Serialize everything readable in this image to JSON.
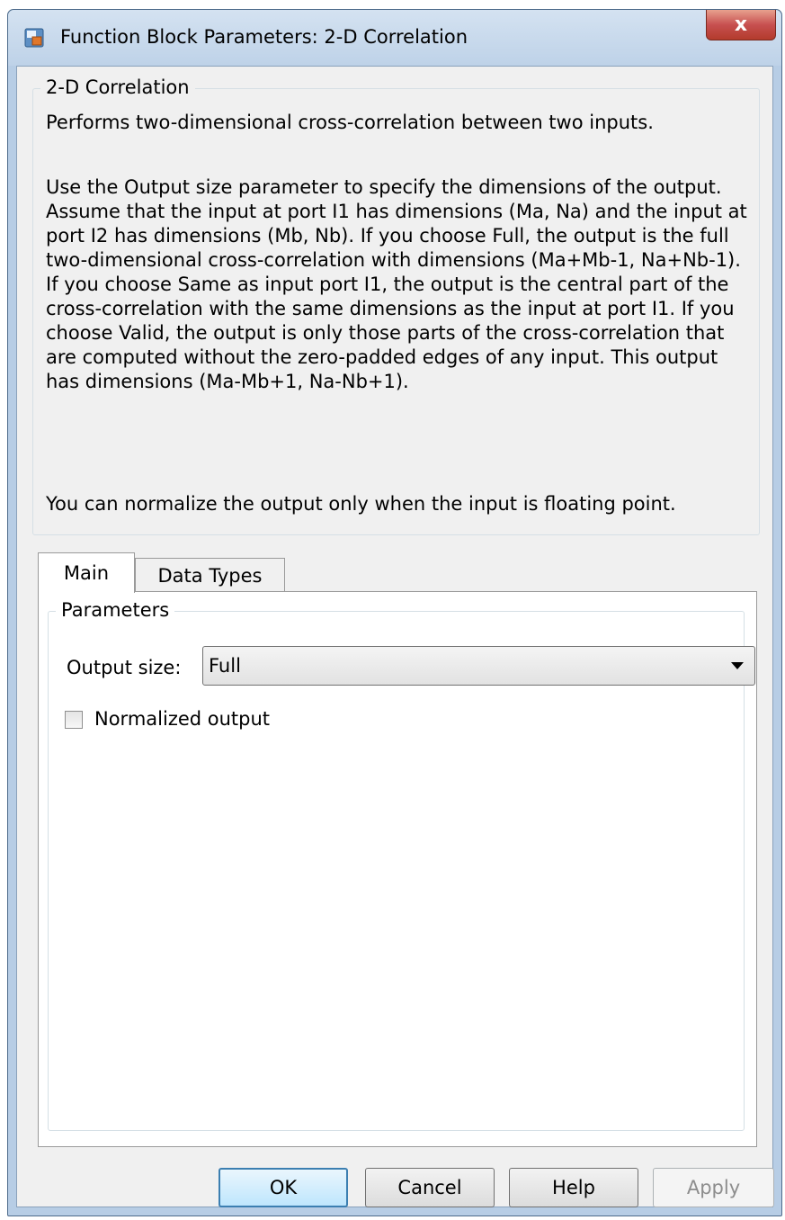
{
  "window": {
    "title": "Function Block Parameters: 2-D Correlation",
    "close_label": "x"
  },
  "description": {
    "group_title": "2-D Correlation",
    "paragraphs": [
      "Performs two-dimensional cross-correlation between two inputs.",
      "Use the Output size parameter to specify the dimensions of the output. Assume that the input at port I1 has dimensions (Ma, Na) and the input at port I2 has dimensions (Mb, Nb). If you choose Full, the output is the full two-dimensional cross-correlation with dimensions (Ma+Mb-1, Na+Nb-1). If you choose Same as input port I1, the output is the central part of the cross-correlation with the same dimensions as the input at port I1. If you choose Valid, the output is only those parts of the cross-correlation that are computed without the zero-padded edges of any input. This output has dimensions (Ma-Mb+1, Na-Nb+1).",
      "You can normalize the output only when the input is floating point."
    ]
  },
  "tabs": [
    {
      "label": "Main",
      "selected": true
    },
    {
      "label": "Data Types",
      "selected": false
    }
  ],
  "parameters": {
    "group_title": "Parameters",
    "output_size_label": "Output size:",
    "output_size_value": "Full",
    "normalized_output_label": "Normalized output",
    "normalized_output_checked": false
  },
  "buttons": {
    "ok": "OK",
    "cancel": "Cancel",
    "help": "Help",
    "apply": "Apply",
    "apply_enabled": false
  }
}
